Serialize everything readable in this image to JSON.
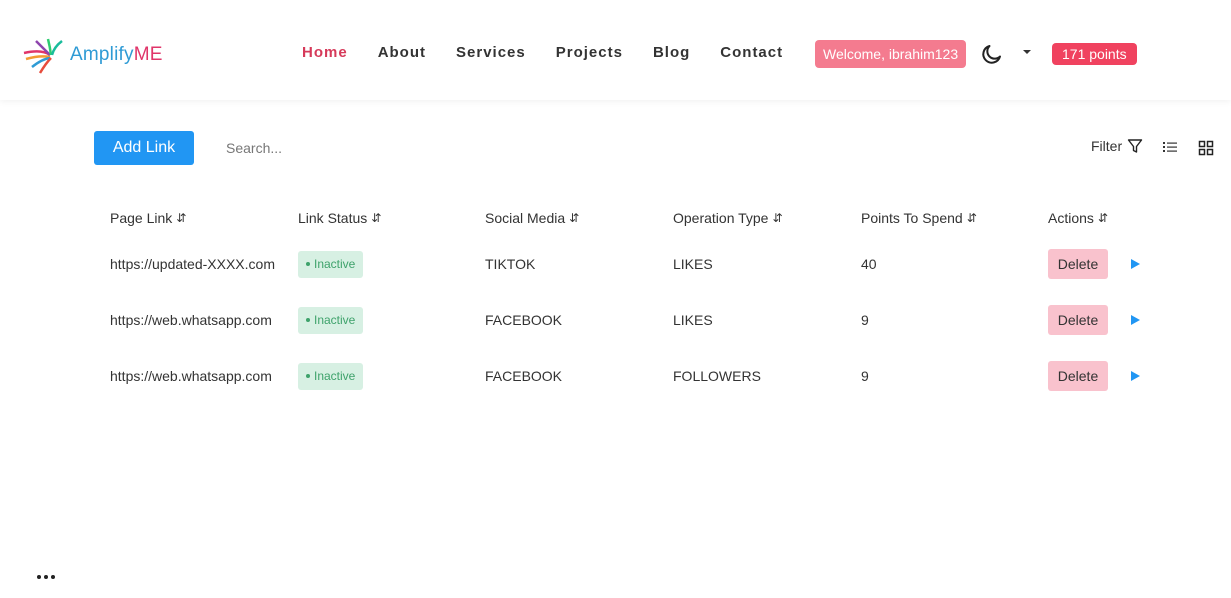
{
  "header": {
    "logo": {
      "text_main": "Amplify",
      "text_accent": "ME",
      "icon": "amplifyme-logo-icon"
    },
    "nav": [
      {
        "label": "Home",
        "active": true
      },
      {
        "label": "About",
        "active": false
      },
      {
        "label": "Services",
        "active": false
      },
      {
        "label": "Projects",
        "active": false
      },
      {
        "label": "Blog",
        "active": false
      },
      {
        "label": "Contact",
        "active": false
      }
    ],
    "welcome": "Welcome, ibrahim123",
    "theme_icon": "moon-icon",
    "menu_icon": "caret-down-icon",
    "points": "171 points"
  },
  "toolbar": {
    "add_label": "Add Link",
    "search_placeholder": "Search...",
    "filter_label": "Filter",
    "filter_icon": "filter-icon",
    "list_view_icon": "list-view-icon",
    "grid_view_icon": "grid-view-icon"
  },
  "table": {
    "columns": [
      "Page Link",
      "Link Status",
      "Social Media",
      "Operation Type",
      "Points To Spend",
      "Actions"
    ],
    "sort_icon": "⇵",
    "rows": [
      {
        "page_link": "https://updated-XXXX.com",
        "status": "Inactive",
        "social": "TIKTOK",
        "operation": "LIKES",
        "points": "40",
        "action": "Delete"
      },
      {
        "page_link": "https://web.whatsapp.com",
        "status": "Inactive",
        "social": "FACEBOOK",
        "operation": "LIKES",
        "points": "9",
        "action": "Delete"
      },
      {
        "page_link": "https://web.whatsapp.com",
        "status": "Inactive",
        "social": "FACEBOOK",
        "operation": "FOLLOWERS",
        "points": "9",
        "action": "Delete"
      }
    ]
  },
  "colors": {
    "primary": "#2196f3",
    "active_nav": "#d63a5a",
    "welcome_bg": "#f47b8f",
    "points_bg": "#f0425f",
    "badge_bg": "#d7f0e3",
    "badge_text": "#3ea26b",
    "delete_bg": "#f9c2cd"
  }
}
